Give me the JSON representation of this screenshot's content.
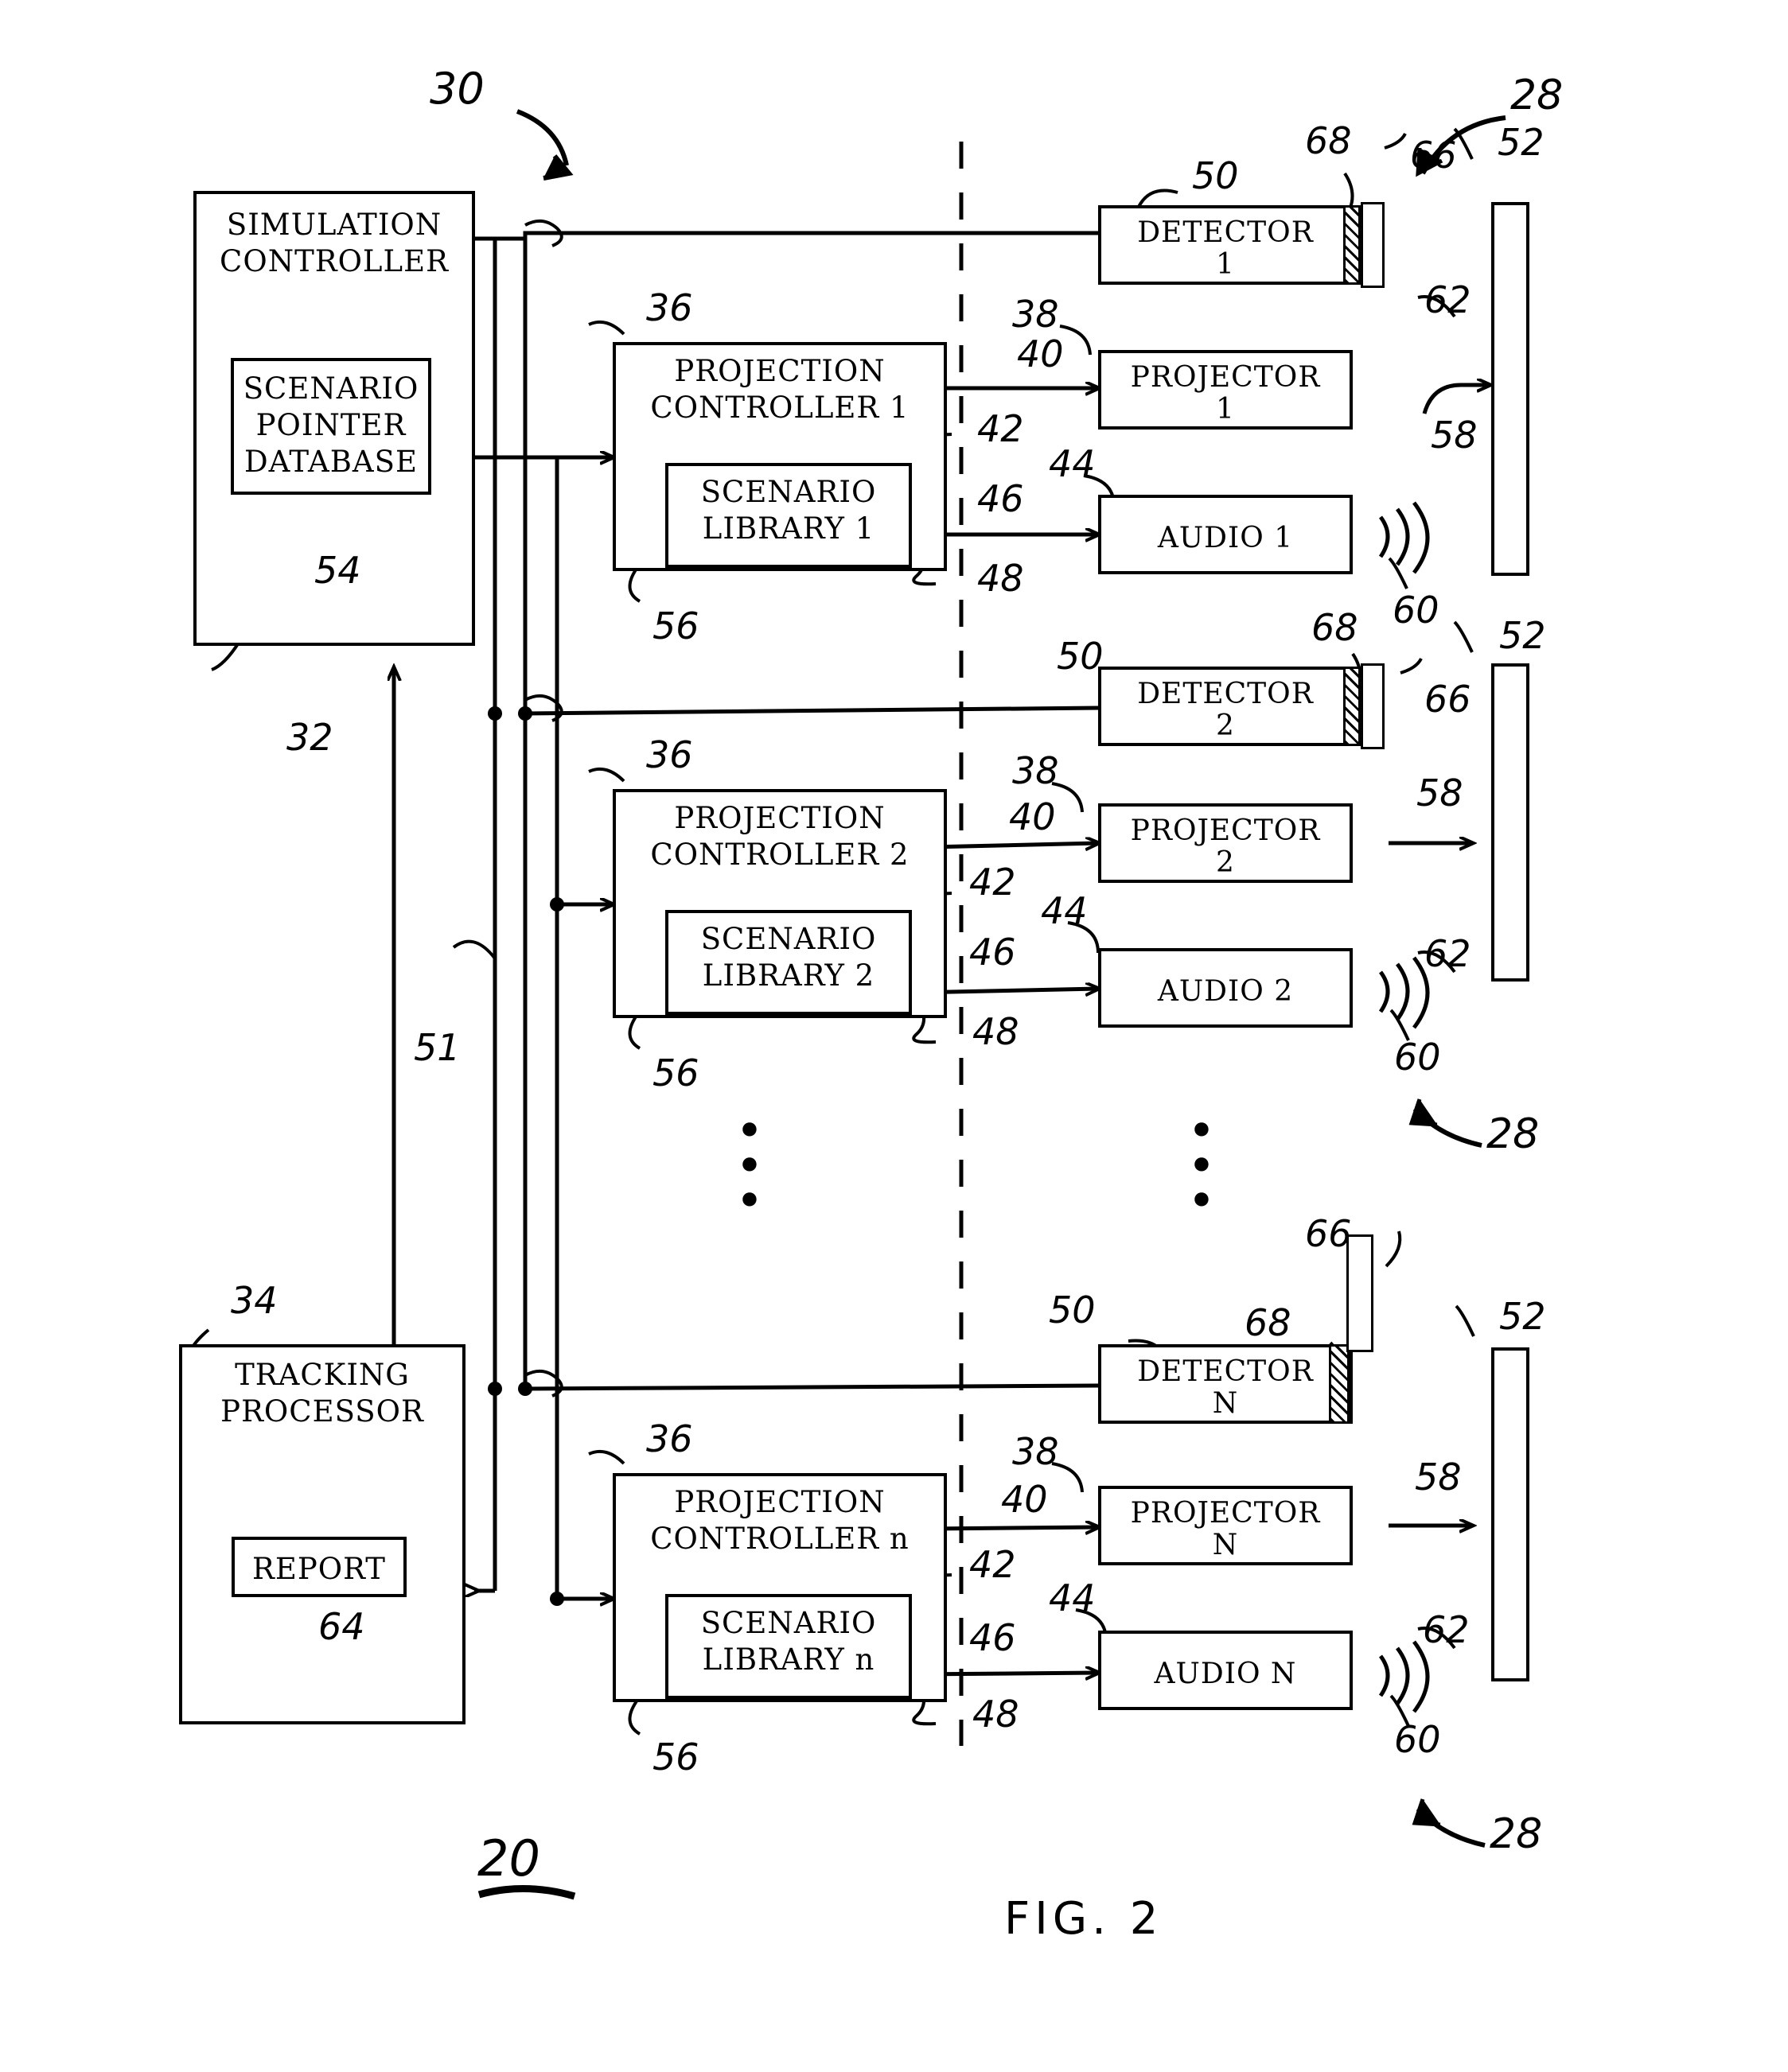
{
  "figure": {
    "caption": "FIG. 2",
    "system_ref": "20",
    "top_ref": "30"
  },
  "blocks": {
    "simulation_controller": {
      "title_line1": "SIMULATION",
      "title_line2": "CONTROLLER",
      "ref": "32",
      "inner": {
        "line1": "SCENARIO",
        "line2": "POINTER",
        "line3": "DATABASE",
        "ref": "54"
      }
    },
    "tracking_processor": {
      "title_line1": "TRACKING",
      "title_line2": "PROCESSOR",
      "ref": "34",
      "inner": {
        "line1": "REPORT",
        "ref": "64"
      }
    },
    "bus_ref": "51"
  },
  "channels": [
    {
      "projection_controller": {
        "line1": "PROJECTION",
        "line2": "CONTROLLER 1",
        "ref": "36",
        "inner": {
          "line1": "SCENARIO",
          "line2": "LIBRARY 1",
          "ref": "56"
        }
      },
      "detector": {
        "label_line1": "DETECTOR",
        "label_line2": "1",
        "ref": "50",
        "filter_ref": "68",
        "screen_ref": "66"
      },
      "projector": {
        "label_line1": "PROJECTOR",
        "label_line2": "1",
        "ref_a": "38",
        "ref_b": "40",
        "ref_c": "42",
        "beam_ref": "58"
      },
      "audio": {
        "label": "AUDIO 1",
        "ref_a": "44",
        "ref_b": "46",
        "ref_c": "48",
        "sound_ref": "60"
      },
      "target": {
        "ref": "52",
        "surface_ref": "62"
      },
      "station_ref": "28"
    },
    {
      "projection_controller": {
        "line1": "PROJECTION",
        "line2": "CONTROLLER 2",
        "ref": "36",
        "inner": {
          "line1": "SCENARIO",
          "line2": "LIBRARY 2",
          "ref": "56"
        }
      },
      "detector": {
        "label_line1": "DETECTOR",
        "label_line2": "2",
        "ref": "50",
        "filter_ref": "68",
        "screen_ref": "66"
      },
      "projector": {
        "label_line1": "PROJECTOR",
        "label_line2": "2",
        "ref_a": "38",
        "ref_b": "40",
        "ref_c": "42",
        "beam_ref": "58"
      },
      "audio": {
        "label": "AUDIO 2",
        "ref_a": "44",
        "ref_b": "46",
        "ref_c": "48",
        "sound_ref": "60"
      },
      "target": {
        "ref": "52",
        "surface_ref": "62"
      },
      "station_ref": "28"
    },
    {
      "projection_controller": {
        "line1": "PROJECTION",
        "line2": "CONTROLLER n",
        "ref": "36",
        "inner": {
          "line1": "SCENARIO",
          "line2": "LIBRARY n",
          "ref": "56"
        }
      },
      "detector": {
        "label_line1": "DETECTOR",
        "label_line2": "N",
        "ref": "50",
        "filter_ref": "68",
        "screen_ref": "66"
      },
      "projector": {
        "label_line1": "PROJECTOR",
        "label_line2": "N",
        "ref_a": "38",
        "ref_b": "40",
        "ref_c": "42",
        "beam_ref": "58"
      },
      "audio": {
        "label": "AUDIO N",
        "ref_a": "44",
        "ref_b": "46",
        "ref_c": "48",
        "sound_ref": "60"
      },
      "target": {
        "ref": "52",
        "surface_ref": "62"
      },
      "station_ref": "28"
    }
  ],
  "ellipsis": {
    "glyph": "•"
  },
  "colors": {
    "ink": "#000000",
    "paper": "#ffffff"
  }
}
